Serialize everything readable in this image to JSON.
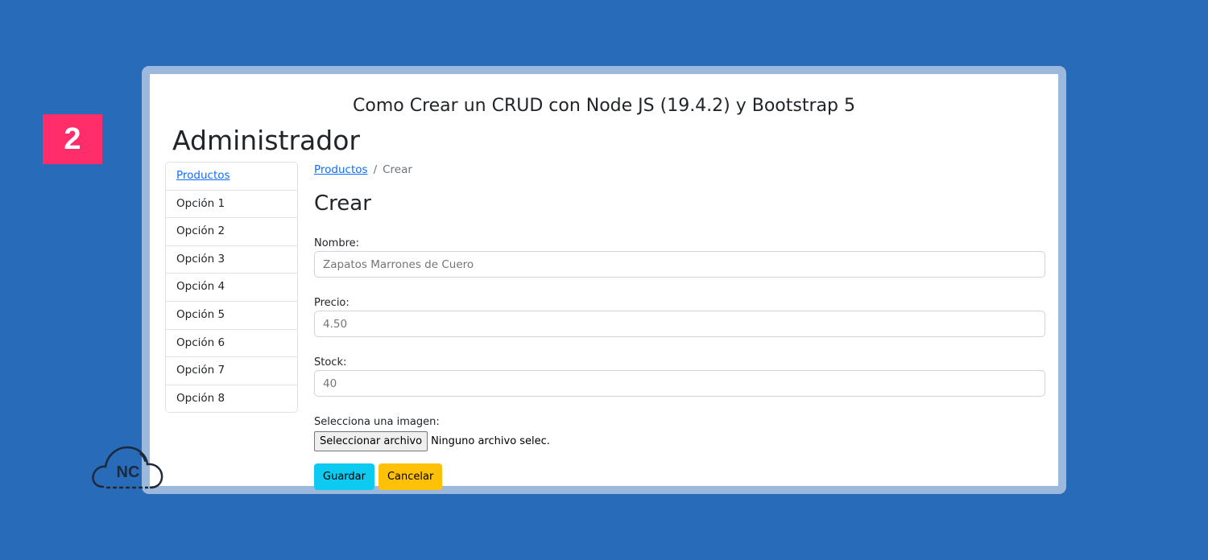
{
  "step_badge": "2",
  "page": {
    "site_title": "Como Crear un CRUD con Node JS (19.4.2) y Bootstrap 5",
    "admin_title": "Administrador"
  },
  "sidebar": {
    "items": [
      {
        "label": "Productos",
        "active": true
      },
      {
        "label": "Opción 1"
      },
      {
        "label": "Opción 2"
      },
      {
        "label": "Opción 3"
      },
      {
        "label": "Opción 4"
      },
      {
        "label": "Opción 5"
      },
      {
        "label": "Opción 6"
      },
      {
        "label": "Opción 7"
      },
      {
        "label": "Opción 8"
      }
    ]
  },
  "breadcrumb": {
    "parent": "Productos",
    "separator": "/",
    "current": "Crear"
  },
  "form": {
    "title": "Crear",
    "nombre": {
      "label": "Nombre:",
      "placeholder": "Zapatos Marrones de Cuero"
    },
    "precio": {
      "label": "Precio:",
      "placeholder": "4.50"
    },
    "stock": {
      "label": "Stock:",
      "placeholder": "40"
    },
    "imagen": {
      "label": "Selecciona una imagen:",
      "button_label": "Seleccionar archivo",
      "status": "Ninguno archivo selec."
    },
    "save_label": "Guardar",
    "cancel_label": "Cancelar"
  },
  "logo": {
    "text": "NC",
    "icon": "cloud-icon"
  },
  "colors": {
    "background": "#286bb8",
    "badge": "#ff2d6a",
    "link": "#0d6efd",
    "save_button": "#0dcaf0",
    "cancel_button": "#ffc107"
  }
}
